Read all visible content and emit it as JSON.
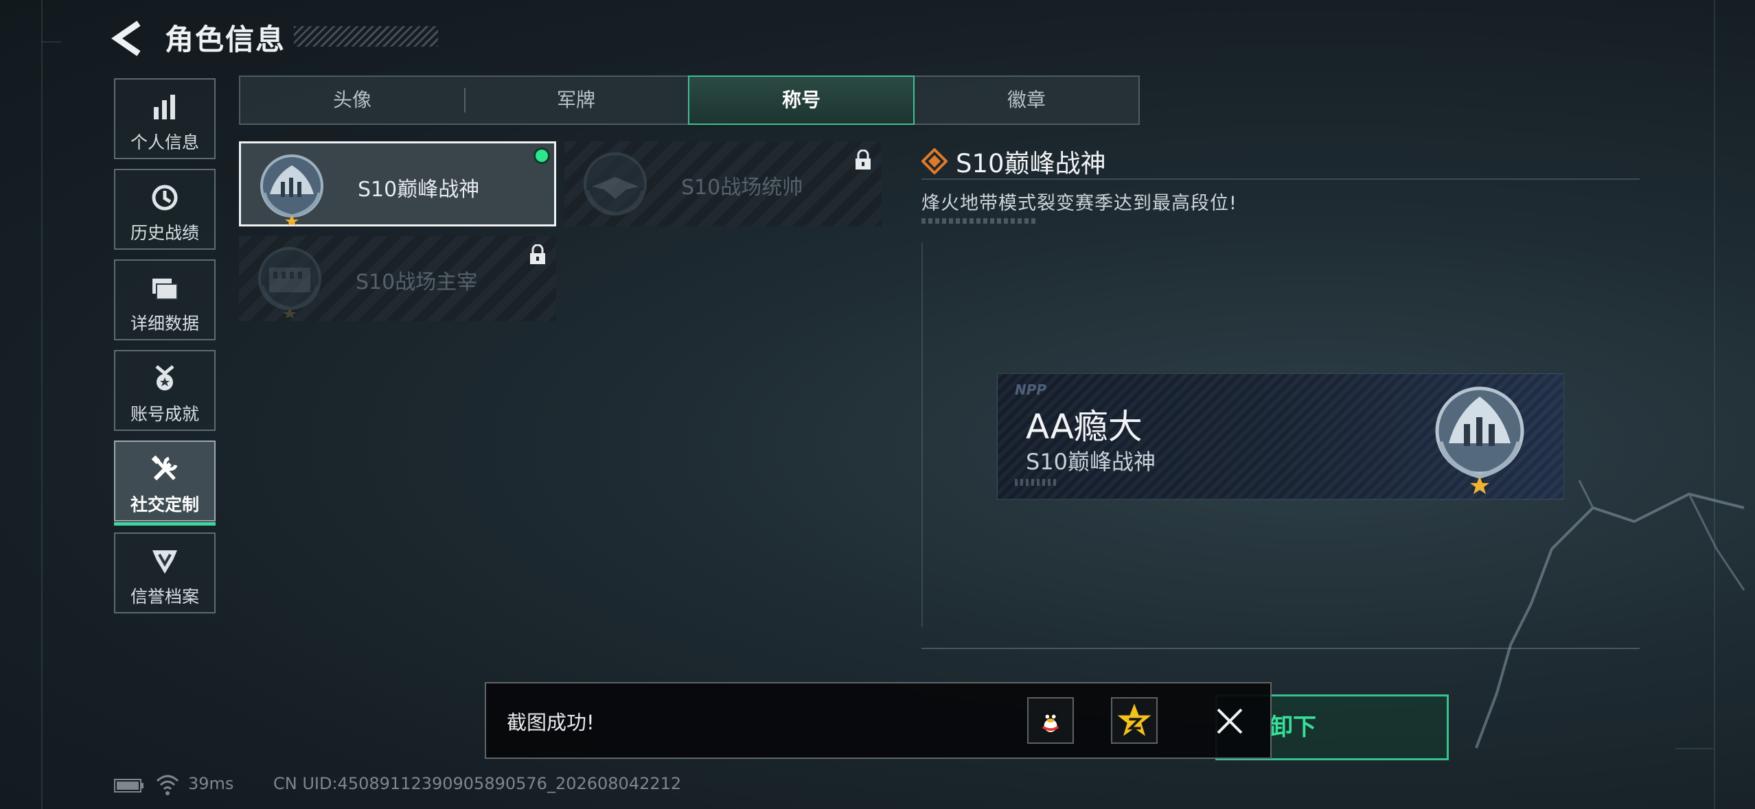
{
  "header": {
    "title": "角色信息"
  },
  "sidebar": {
    "items": [
      {
        "label": "个人信息",
        "icon": "bar-chart-icon",
        "active": false
      },
      {
        "label": "历史战绩",
        "icon": "clock-history-icon",
        "active": false
      },
      {
        "label": "详细数据",
        "icon": "folder-icon",
        "active": false
      },
      {
        "label": "账号成就",
        "icon": "medal-icon",
        "active": false
      },
      {
        "label": "社交定制",
        "icon": "tools-icon",
        "active": true
      },
      {
        "label": "信誉档案",
        "icon": "shield-wing-icon",
        "active": false
      }
    ]
  },
  "tabs": [
    {
      "label": "头像",
      "active": false
    },
    {
      "label": "军牌",
      "active": false
    },
    {
      "label": "称号",
      "active": true
    },
    {
      "label": "徽章",
      "active": false
    }
  ],
  "titles": [
    {
      "name": "S10巅峰战神",
      "state": "equipped"
    },
    {
      "name": "S10战场统帅",
      "state": "locked"
    },
    {
      "name": "S10战场主宰",
      "state": "locked"
    }
  ],
  "detail": {
    "title": "S10巅峰战神",
    "description": "烽火地带模式裂变赛季达到最高段位!"
  },
  "preview": {
    "logo": "NPP",
    "player_name": "AA瘾大",
    "title": "S10巅峰战神"
  },
  "action": {
    "label": "卸下"
  },
  "toast": {
    "message": "截图成功!",
    "share_icons": [
      "qq-icon",
      "qzone-icon"
    ]
  },
  "status": {
    "ping": "39ms",
    "uid": "CN UID:4508911239090589057​6_202608042212"
  },
  "colors": {
    "accent": "#3fd6a0",
    "online_dot": "#2ee58e",
    "title_icon": "#e07a2a"
  }
}
